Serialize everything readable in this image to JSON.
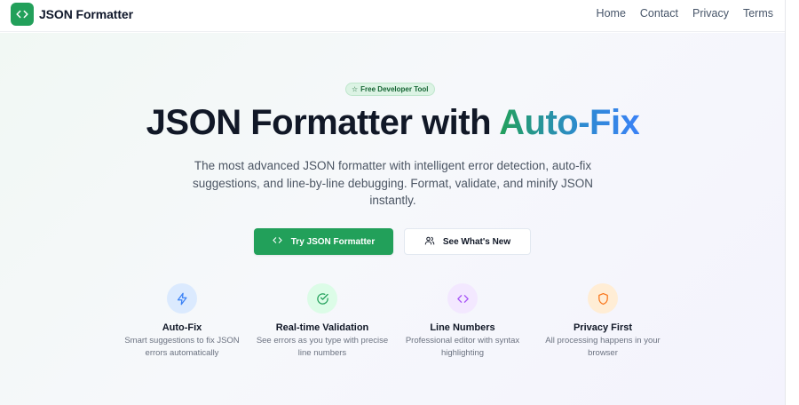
{
  "header": {
    "brand": "JSON Formatter",
    "logo_icon": "code-brackets-icon",
    "nav": [
      "Home",
      "Contact",
      "Privacy",
      "Terms"
    ]
  },
  "hero": {
    "badge": "Free Developer Tool",
    "title_main": "JSON Formatter with ",
    "title_accent": "Auto-Fix",
    "subtitle": "The most advanced JSON formatter with intelligent error detection, auto-fix suggestions, and line-by-line debugging. Format, validate, and minify JSON instantly.",
    "primary_button": "Try JSON Formatter",
    "secondary_button": "See What's New"
  },
  "features": [
    {
      "title": "Auto-Fix",
      "desc": "Smart suggestions to fix JSON errors automatically",
      "icon": "lightning-icon",
      "color": "#3b82f6",
      "bg": "#dbeafe"
    },
    {
      "title": "Real-time Validation",
      "desc": "See errors as you type with precise line numbers",
      "icon": "check-circle-icon",
      "color": "#22a05a",
      "bg": "#dcfce7"
    },
    {
      "title": "Line Numbers",
      "desc": "Professional editor with syntax highlighting",
      "icon": "code-brackets-icon",
      "color": "#a855f7",
      "bg": "#f3e8ff"
    },
    {
      "title": "Privacy First",
      "desc": "All processing happens in your browser",
      "icon": "shield-icon",
      "color": "#f97316",
      "bg": "#ffedd5"
    }
  ],
  "colors": {
    "brand": "#22a05a",
    "accent_blue": "#3b82f6"
  }
}
